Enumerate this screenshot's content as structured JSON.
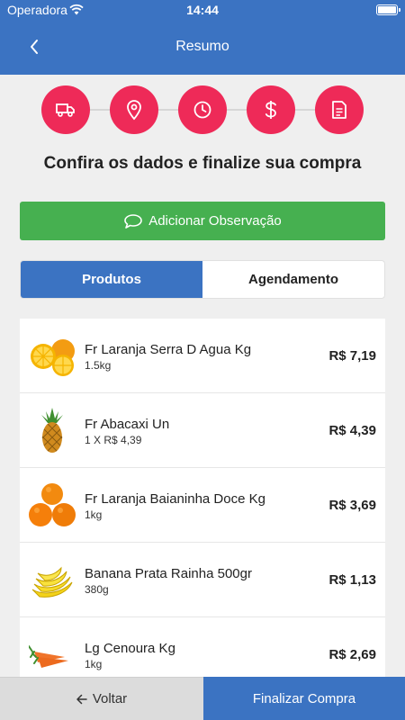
{
  "status_bar": {
    "carrier": "Operadora",
    "time": "14:44"
  },
  "header": {
    "title": "Resumo",
    "back_icon": "chevron-left-icon"
  },
  "steps": [
    {
      "icon": "truck-icon"
    },
    {
      "icon": "location-pin-icon"
    },
    {
      "icon": "clock-icon"
    },
    {
      "icon": "dollar-icon"
    },
    {
      "icon": "document-icon"
    }
  ],
  "heading": "Confira os dados e finalize sua compra",
  "observation_button": {
    "label": "Adicionar Observação",
    "icon": "chat-bubble-icon"
  },
  "tabs": [
    {
      "label": "Produtos",
      "active": true
    },
    {
      "label": "Agendamento",
      "active": false
    }
  ],
  "products": [
    {
      "name": "Fr Laranja Serra D Agua Kg",
      "qty": "1.5kg",
      "price": "R$ 7,19",
      "image": "orange-halves"
    },
    {
      "name": "Fr Abacaxi Un",
      "qty": "1 X R$ 4,39",
      "price": "R$ 4,39",
      "image": "pineapple"
    },
    {
      "name": "Fr Laranja Baianinha Doce Kg",
      "qty": "1kg",
      "price": "R$ 3,69",
      "image": "oranges"
    },
    {
      "name": "Banana Prata Rainha 500gr",
      "qty": "380g",
      "price": "R$ 1,13",
      "image": "bananas"
    },
    {
      "name": "Lg Cenoura Kg",
      "qty": "1kg",
      "price": "R$ 2,69",
      "image": "carrots"
    }
  ],
  "footer": {
    "back_label": "Voltar",
    "finish_label": "Finalizar Compra"
  },
  "colors": {
    "primary": "#3b73c2",
    "step": "#ee2a58",
    "success": "#46b050"
  }
}
